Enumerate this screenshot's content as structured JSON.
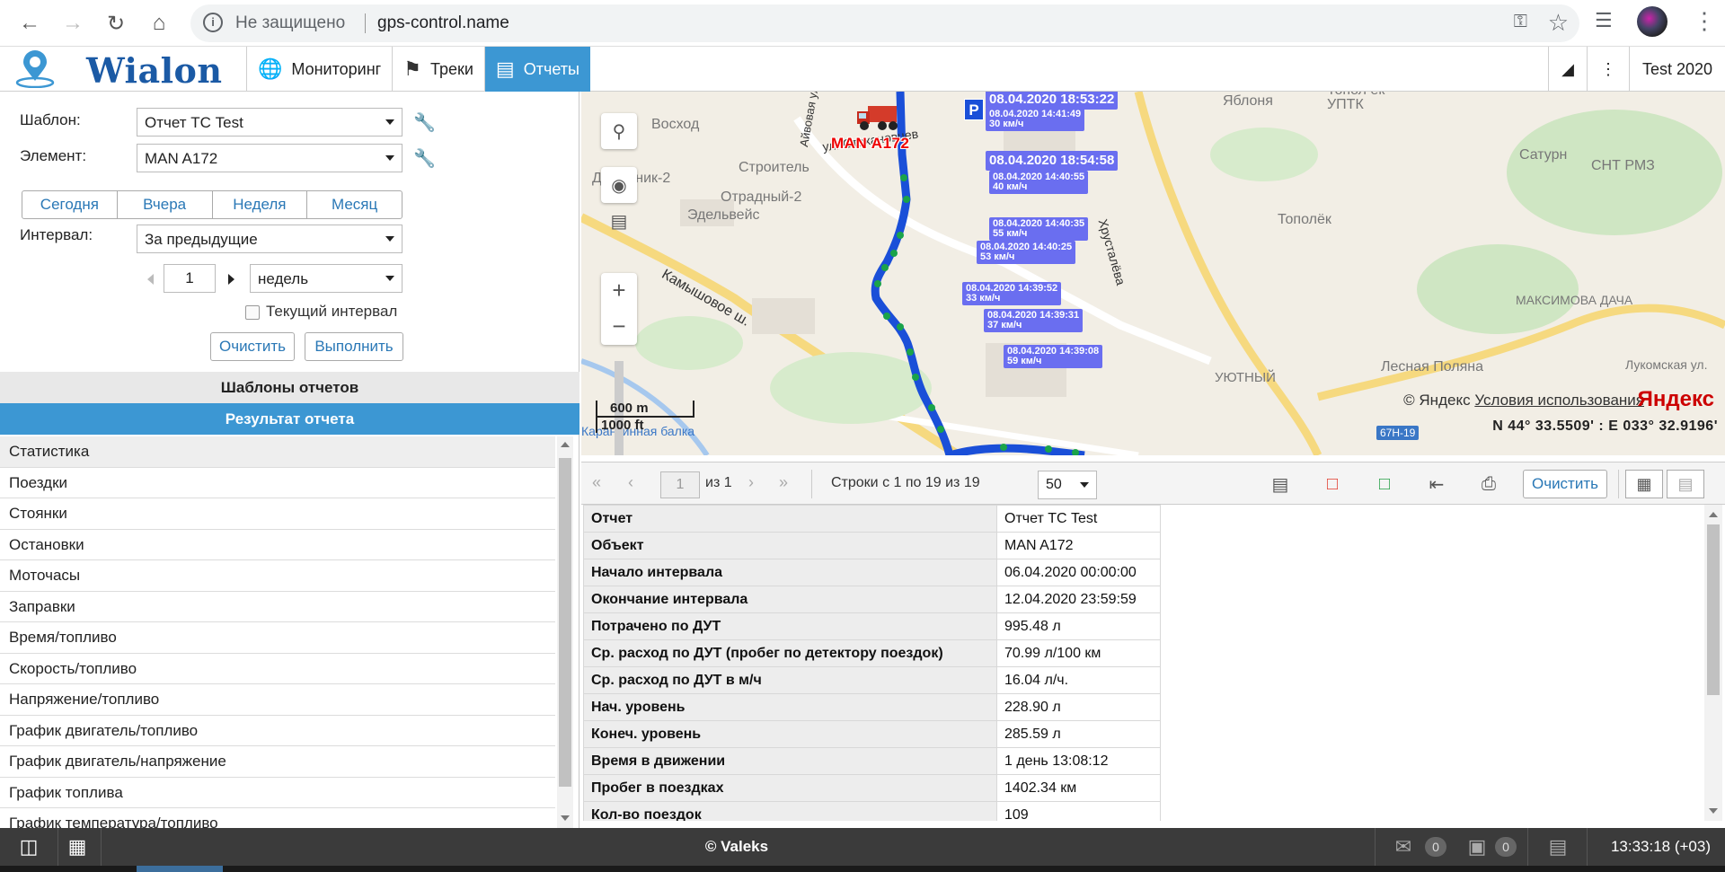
{
  "browser": {
    "insecure_label": "Не защищено",
    "url": "gps-control.name"
  },
  "app": {
    "logo_text": "Wialon",
    "tabs": [
      {
        "label": "Мониторинг",
        "icon": "globe-icon"
      },
      {
        "label": "Треки",
        "icon": "checkered-flag-icon"
      },
      {
        "label": "Отчеты",
        "icon": "report-chart-icon",
        "active": true
      }
    ],
    "user": "Test 2020"
  },
  "form": {
    "template_label": "Шаблон:",
    "template_value": "Отчет ТС Test",
    "element_label": "Элемент:",
    "element_value": "MAN A172",
    "periods": [
      "Сегодня",
      "Вчера",
      "Неделя",
      "Месяц"
    ],
    "interval_label": "Интервал:",
    "interval_value": "За предыдущие",
    "count_value": "1",
    "unit_value": "недель",
    "current_interval_label": "Текущий интервал",
    "clear_label": "Очистить",
    "execute_label": "Выполнить"
  },
  "sections": {
    "templates": "Шаблоны отчетов",
    "result": "Результат отчета"
  },
  "result_items": [
    "Статистика",
    "Поездки",
    "Стоянки",
    "Остановки",
    "Моточасы",
    "Заправки",
    "Время/топливо",
    "Скорость/топливо",
    "Напряжение/топливо",
    "График двигатель/топливо",
    "График двигатель/напряжение",
    "График топлива",
    "График температура/топливо"
  ],
  "map": {
    "unit_name": "MAN A172",
    "labels": [
      "Восход",
      "Дорожник-2",
      "Строитель",
      "Отрадный-2",
      "Эдельвейс",
      "Камышовое ш.",
      "ул. Стахановцев",
      "Хрусталёва",
      "Айвовая ул.",
      "Яблоня",
      "УПТК",
      "Сатурн",
      "СНТ РМЗ",
      "Тополёк",
      "МАКСИМОВА ДАЧА",
      "Лесная Поляна",
      "Лукомская ул.",
      "УЮТНЫЙ",
      "Карантинная балка",
      "Топол ек"
    ],
    "points": [
      {
        "time": "08.04.2020 18:53:22",
        "speed": ""
      },
      {
        "time": "08.04.2020 14:41:49",
        "speed": "30 км/ч"
      },
      {
        "time": "08.04.2020 18:54:58",
        "speed": ""
      },
      {
        "time": "08.04.2020 14:40:55",
        "speed": "40 км/ч"
      },
      {
        "time": "08.04.2020 14:40:35",
        "speed": "55 км/ч"
      },
      {
        "time": "08.04.2020 14:40:25",
        "speed": "53 км/ч"
      },
      {
        "time": "08.04.2020 14:39:52",
        "speed": "33 км/ч"
      },
      {
        "time": "08.04.2020 14:39:31",
        "speed": "37 км/ч"
      },
      {
        "time": "08.04.2020 14:39:08",
        "speed": "59 км/ч"
      }
    ],
    "parking_marker": "P",
    "scale_m": "600 m",
    "scale_ft": "1000 ft",
    "copyright": "© Яндекс",
    "terms_link": "Условия использования",
    "brand": "Яндекс",
    "road_badge": "67Н-19",
    "coords": "N 44° 33.5509' : E 033° 32.9196'"
  },
  "toolbar": {
    "page_value": "1",
    "of_label": "из 1",
    "rows_info": "Строки с 1 по 19 из 19",
    "rows_per_page": "50",
    "clear_label": "Очистить"
  },
  "report": [
    {
      "key": "Отчет",
      "value": "Отчет ТС Test"
    },
    {
      "key": "Объект",
      "value": "MAN A172"
    },
    {
      "key": "Начало интервала",
      "value": "06.04.2020 00:00:00"
    },
    {
      "key": "Окончание интервала",
      "value": "12.04.2020 23:59:59"
    },
    {
      "key": "Потрачено по ДУТ",
      "value": "995.48 л"
    },
    {
      "key": "Ср. расход по ДУТ (пробег по детектору поездок)",
      "value": "70.99 л/100 км"
    },
    {
      "key": "Ср. расход по ДУТ в м/ч",
      "value": "16.04 л/ч."
    },
    {
      "key": "Нач. уровень",
      "value": "228.90 л"
    },
    {
      "key": "Конеч. уровень",
      "value": "285.59 л"
    },
    {
      "key": "Время в движении",
      "value": "1 день 13:08:12"
    },
    {
      "key": "Пробег в поездках",
      "value": "1402.34 км"
    },
    {
      "key": "Кол-во поездок",
      "value": "109"
    }
  ],
  "statusbar": {
    "center": "© Valeks",
    "messages_count": "0",
    "images_count": "0",
    "time": "13:33:18 (+03)"
  }
}
